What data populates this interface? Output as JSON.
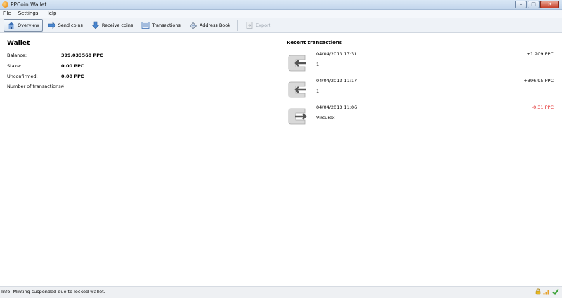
{
  "window": {
    "title": "PPCoin Wallet"
  },
  "menu": [
    "File",
    "Settings",
    "Help"
  ],
  "toolbar": {
    "overview": "Overview",
    "send": "Send coins",
    "receive": "Receive coins",
    "transactions": "Transactions",
    "address_book": "Address Book",
    "export": "Export"
  },
  "wallet": {
    "title": "Wallet",
    "balance_label": "Balance:",
    "balance_value": "399.033568 PPC",
    "stake_label": "Stake:",
    "stake_value": "0.00 PPC",
    "unconfirmed_label": "Unconfirmed:",
    "unconfirmed_value": "0.00 PPC",
    "ntx_label": "Number of transactions:",
    "ntx_value": "4"
  },
  "recent": {
    "title": "Recent transactions",
    "items": [
      {
        "date": "04/04/2013 17:31",
        "address": "1",
        "amount": "+1.209 PPC",
        "direction": "in"
      },
      {
        "date": "04/04/2013 11:17",
        "address": "1",
        "amount": "+396.95 PPC",
        "direction": "in"
      },
      {
        "date": "04/04/2013 11:06",
        "address": "Vircurex",
        "amount": "-0.31 PPC",
        "direction": "out"
      }
    ]
  },
  "status": {
    "text": "Info: Minting suspended due to locked wallet."
  },
  "colors": {
    "negative": "#e02020",
    "accent": "#3c6fb4"
  }
}
